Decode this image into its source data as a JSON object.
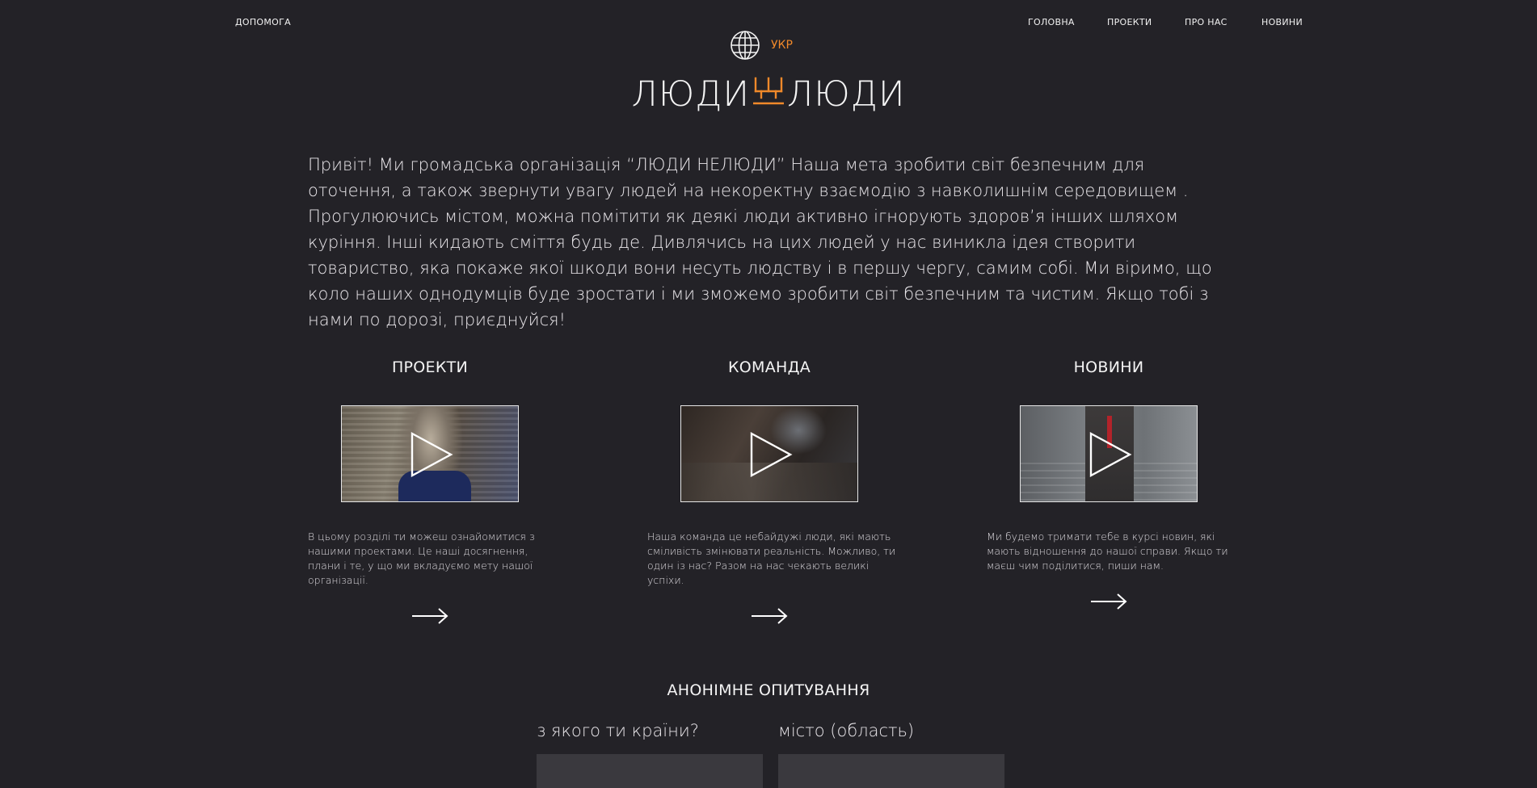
{
  "header": {
    "help": "ДОПОМОГА",
    "nav": [
      "ГОЛОВНА",
      "ПРОЕКТИ",
      "ПРО НАС",
      "НОВИНИ"
    ],
    "lang": "УКР"
  },
  "logo": {
    "left": "ЛЮДИ",
    "right": "ЛЮДИ",
    "accent": "#f0892a"
  },
  "intro": "Привіт! Ми громадська організація “ЛЮДИ НЕЛЮДИ” Наша мета зробити світ безпечним для оточення, а також звернути увагу людей на некоректну взаємодію з навколишнім середовищем . Прогулюючись містом, можна помітити як деякі люди активно ігнорують здоров’я інших шляхом куріння. Інші кидають сміття будь де. Дивлячись на цих людей у нас виникла ідея створити товариство, яка покаже якої шкоди вони несуть людству і в першу чергу, самим собі. Ми віримо, що коло наших однодумців буде зростати і ми зможемо зробити світ безпечним та чистим. Якщо тобі з нами по дорозі, приєднуйся!",
  "sections": [
    {
      "title": "ПРОЕКТИ",
      "text": "В цьому розділі ти можеш ознайомитися з нашими проектами. Це наші досягнення, плани і те, у що ми вкладуємо мету нашої організації."
    },
    {
      "title": "КОМАНДА",
      "text": "Наша команда це небайдужі люди, які мають сміливість змінювати реальність. Можливо, ти один із нас? Разом на нас чекають великі успіхи."
    },
    {
      "title": "НОВИНИ",
      "text": "Ми будемо тримати тебе в курсі новин, які мають відношення до нашої справи. Якщо ти маєш чим поділитися, пиши нам."
    }
  ],
  "survey": {
    "title": "АНОНІМНЕ ОПИТУВАННЯ",
    "q1": "з якого ти країни?",
    "q2": "місто (область)"
  }
}
